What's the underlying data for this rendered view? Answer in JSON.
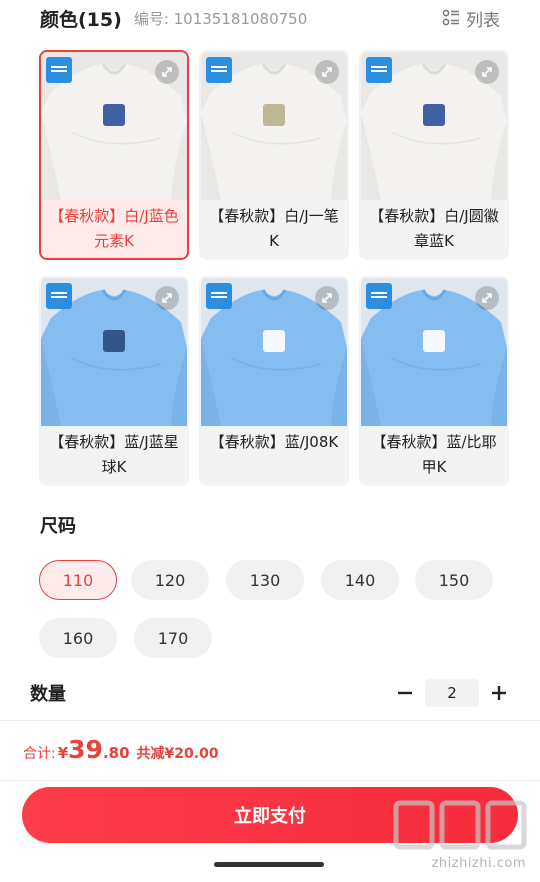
{
  "header": {
    "color_title": "颜色(15)",
    "code": "编号: 10135181080750",
    "view_label": "列表"
  },
  "colors": [
    {
      "label": "【春秋款】白/J蓝色元素K",
      "shirt": "#f4f3f1",
      "accent": "#2e4f9a",
      "selected": true
    },
    {
      "label": "【春秋款】白/J一笔K",
      "shirt": "#f4f3f1",
      "accent": "#b8b08a",
      "selected": false
    },
    {
      "label": "【春秋款】白/J圆徽章蓝K",
      "shirt": "#f4f3f1",
      "accent": "#2e4f9a",
      "selected": false
    },
    {
      "label": "【春秋款】蓝/J蓝星球K",
      "shirt": "#86bdf0",
      "accent": "#2a4a7e",
      "selected": false
    },
    {
      "label": "【春秋款】蓝/J08K",
      "shirt": "#86bdf0",
      "accent": "#ffffff",
      "selected": false
    },
    {
      "label": "【春秋款】蓝/比耶甲K",
      "shirt": "#86bdf0",
      "accent": "#ffffff",
      "selected": false
    }
  ],
  "size": {
    "title": "尺码",
    "options": [
      "110",
      "120",
      "130",
      "140",
      "150",
      "160",
      "170"
    ],
    "selected": "110"
  },
  "quantity": {
    "label": "数量",
    "value": "2"
  },
  "total": {
    "label": "合计:",
    "currency": "¥",
    "integer": "39",
    "decimal": ".80",
    "saving": "共减¥20.00"
  },
  "pay_button": "立即支付",
  "watermark": "zhizhizhi.com",
  "theme": {
    "accent": "#e8413e"
  }
}
